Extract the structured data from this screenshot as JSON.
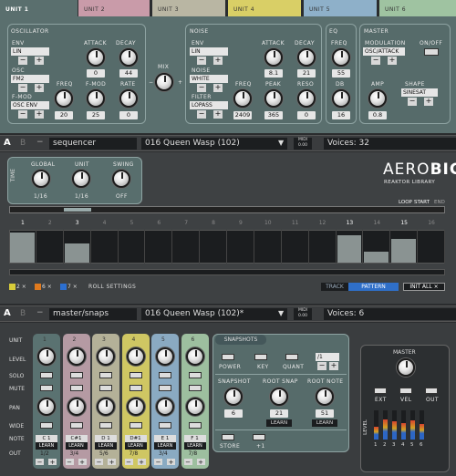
{
  "tabs": [
    "UNIT 1",
    "UNIT 2",
    "UNIT 3",
    "UNIT 4",
    "UNIT 5",
    "UNIT 6"
  ],
  "tab_colors": [
    "#5a6f6e",
    "#c99ba9",
    "#b9b6a3",
    "#d9cf66",
    "#8eb0c9",
    "#9fc3a1"
  ],
  "osc": {
    "title": "OSCILLATOR",
    "env_label": "ENV",
    "env_menu": "LIN",
    "osc_label": "OSC",
    "osc_menu": "FM2",
    "fmod_label": "F-MOD",
    "fmod_menu": "OSC ENV",
    "attack_label": "ATTACK",
    "attack": "0",
    "decay_label": "DECAY",
    "decay": "44",
    "freq_label": "FREQ",
    "freq": "20",
    "fmod_knob_label": "F-MOD",
    "fmod_knob": "25",
    "rate_label": "RATE",
    "rate": "0"
  },
  "mix_label": "MIX",
  "noise": {
    "title": "NOISE",
    "env_label": "ENV",
    "env_menu": "LIN",
    "noise_label": "NOISE",
    "noise_menu": "WHITE",
    "filter_label": "FILTER",
    "filter_menu": "LOPASS",
    "attack_label": "ATTACK",
    "attack": "8.1",
    "decay_label": "DECAY",
    "decay": "21",
    "freq_label": "FREQ",
    "freq": "2409",
    "peak_label": "PEAK",
    "peak": "365",
    "reso_label": "RESO",
    "reso": "0"
  },
  "eq": {
    "title": "EQ",
    "freq_label": "FREQ",
    "freq": "55",
    "db_label": "DB",
    "db": "16"
  },
  "master": {
    "title": "MASTER",
    "mod_label": "MODULATION",
    "mod_menu": "OSC/ATTACK",
    "onoff_label": "ON/OFF",
    "amp_label": "AMP",
    "amp": "0.8",
    "shape_label": "SHAPE",
    "shape_menu": "SINESAT"
  },
  "seqbar": {
    "a": "A",
    "b": "B",
    "dash": "−",
    "name": "sequencer",
    "preset": "016  Queen Wasp (102)",
    "midi": "MIDI 0.00",
    "voices": "Voices: 32"
  },
  "seq": {
    "time_label": "TIME",
    "global_label": "GLOBAL",
    "global": "1/16",
    "unit_label": "UNIT",
    "unit": "1/16",
    "swing_label": "SWING",
    "swing": "OFF",
    "logo1": "AERO",
    "logo2": "BIC",
    "logo_sub": "REAKTOR LIBRARY",
    "loop_label": "LOOP",
    "start_label": "START",
    "end_label": "END",
    "steps": [
      "1",
      "2",
      "3",
      "4",
      "5",
      "6",
      "7",
      "8",
      "9",
      "10",
      "11",
      "12",
      "13",
      "14",
      "15",
      "16"
    ],
    "step_values": [
      0.95,
      0,
      0.6,
      0,
      0,
      0,
      0,
      0,
      0,
      0,
      0,
      0,
      0.85,
      0.35,
      0.75,
      0
    ],
    "roll": [
      "2 ×",
      "6 ×",
      "7 ×"
    ],
    "roll_label": "ROLL SETTINGS",
    "track": "TRACK",
    "pattern": "PATTERN",
    "init": "INIT ALL ×"
  },
  "snapbar": {
    "a": "A",
    "b": "B",
    "dash": "−",
    "name": "master/snaps",
    "preset": "016  Queen Wasp (102)*",
    "midi": "MIDI 0.00",
    "voices": "Voices: 6"
  },
  "rows": [
    "UNIT",
    "LEVEL",
    "SOLO",
    "MUTE",
    "PAN",
    "WIDE",
    "NOTE",
    "OUT"
  ],
  "channels": [
    {
      "n": "1",
      "note": "C 1",
      "out": "1/2",
      "color": "#5a7271"
    },
    {
      "n": "2",
      "note": "C#1",
      "out": "3/4",
      "color": "#b59aa3"
    },
    {
      "n": "3",
      "note": "D 1",
      "out": "5/6",
      "color": "#b4b198"
    },
    {
      "n": "4",
      "note": "D#1",
      "out": "7/8",
      "color": "#cfc763"
    },
    {
      "n": "5",
      "note": "E 1",
      "out": "3/4",
      "color": "#8aaac2"
    },
    {
      "n": "6",
      "note": "F 1",
      "out": "7/8",
      "color": "#9dbf9f"
    }
  ],
  "learn": "LEARN",
  "snap": {
    "title": "SNAPSHOTS",
    "power": "POWER",
    "key": "KEY",
    "quant": "QUANT",
    "range": "/1",
    "snapshot_label": "SNAPSHOT",
    "snapshot": "6",
    "root_snap_label": "ROOT SNAP",
    "root_snap": "21",
    "root_note_label": "ROOT NOTE",
    "root_note": "51",
    "store": "STORE",
    "plus1": "+1"
  },
  "masterbox": {
    "title": "MASTER",
    "level_label": "LEVEL",
    "ext": "EXT",
    "vel": "VEL",
    "out": "OUT",
    "meters": [
      "1",
      "2",
      "3",
      "4",
      "5",
      "6"
    ]
  }
}
